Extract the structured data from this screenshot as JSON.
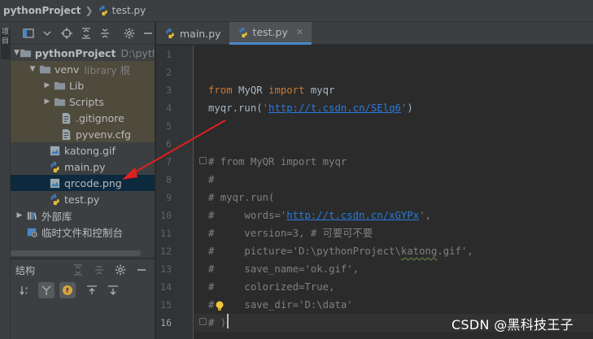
{
  "breadcrumb": {
    "project": "pythonProject",
    "file": "test.py"
  },
  "left_stripe": {
    "tab_label": "项目"
  },
  "project_tree": [
    {
      "label": "pythonProject",
      "extra": "D:\\pyth",
      "type": "project-folder",
      "expanded": true,
      "depth": 0,
      "bold": true
    },
    {
      "label": "venv",
      "extra": "library 根",
      "type": "folder",
      "expanded": true,
      "depth": 1
    },
    {
      "label": "Lib",
      "type": "folder",
      "expanded": false,
      "depth": 2
    },
    {
      "label": "Scripts",
      "type": "folder",
      "expanded": false,
      "depth": 2
    },
    {
      "label": ".gitignore",
      "type": "file",
      "depth": 3
    },
    {
      "label": "pyvenv.cfg",
      "type": "file",
      "depth": 3
    },
    {
      "label": "katong.gif",
      "type": "image",
      "depth": 2
    },
    {
      "label": "main.py",
      "type": "python",
      "depth": 2
    },
    {
      "label": "qrcode.png",
      "type": "image",
      "depth": 2,
      "selected": true
    },
    {
      "label": "test.py",
      "type": "python",
      "depth": 2
    },
    {
      "label": "外部库",
      "type": "library",
      "expanded": false,
      "depth": 0
    },
    {
      "label": "临时文件和控制台",
      "type": "scratches",
      "depth": 0
    }
  ],
  "structure": {
    "title": "结构"
  },
  "tabs": [
    {
      "label": "main.py",
      "active": false
    },
    {
      "label": "test.py",
      "active": true
    }
  ],
  "editor": {
    "line_numbers": [
      "1",
      "2",
      "3",
      "4",
      "5",
      "6",
      "7",
      "8",
      "9",
      "10",
      "11",
      "12",
      "13",
      "14",
      "15",
      "16"
    ],
    "current_line": "16",
    "lines": [
      [],
      [],
      [
        {
          "t": "from",
          "c": "kw"
        },
        {
          "t": " MyQR ",
          "c": "pl"
        },
        {
          "t": "import",
          "c": "kw"
        },
        {
          "t": " myqr",
          "c": "pl"
        }
      ],
      [
        {
          "t": "myqr.run(",
          "c": "pl"
        },
        {
          "t": "'",
          "c": "str"
        },
        {
          "t": "http://t.csdn.cn/SElq6",
          "c": "url"
        },
        {
          "t": "'",
          "c": "str"
        },
        {
          "t": ")",
          "c": "pl"
        }
      ],
      [],
      [],
      [
        {
          "t": "# from MyQR import myqr",
          "c": "cm"
        }
      ],
      [
        {
          "t": "#",
          "c": "cm"
        }
      ],
      [
        {
          "t": "# myqr.run(",
          "c": "cm"
        }
      ],
      [
        {
          "t": "#     words='",
          "c": "cm"
        },
        {
          "t": "http://t.csdn.cn/xGYPx",
          "c": "url"
        },
        {
          "t": "',",
          "c": "cm"
        }
      ],
      [
        {
          "t": "#     version=3, # 可要可不要",
          "c": "cm"
        }
      ],
      [
        {
          "t": "#     picture='D:\\pythonProject\\",
          "c": "cm"
        },
        {
          "t": "katong",
          "c": "cm typo"
        },
        {
          "t": ".gif',",
          "c": "cm"
        }
      ],
      [
        {
          "t": "#     save_name='ok.gif',",
          "c": "cm"
        }
      ],
      [
        {
          "t": "#     colorized=True,",
          "c": "cm"
        }
      ],
      [
        {
          "t": "#     save_dir='D:\\data'",
          "c": "cm"
        }
      ],
      [
        {
          "t": "# )",
          "c": "cm"
        }
      ]
    ]
  },
  "watermark": "CSDN @黑科技王子",
  "colors": {
    "accent": "#4a88c7",
    "arrow": "#e02020",
    "selection": "#0d293e"
  }
}
